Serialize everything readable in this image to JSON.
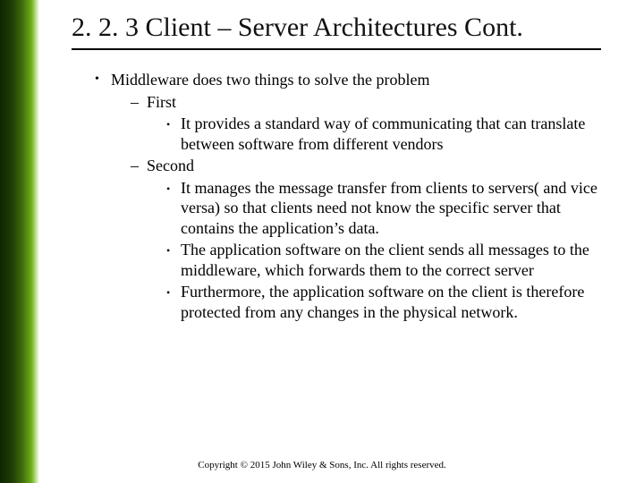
{
  "slide": {
    "title": "2. 2. 3 Client – Server Architectures Cont.",
    "body": {
      "top": "Middleware does two things to solve the problem",
      "first_label": "First",
      "first_items": [
        "It provides a standard way of communicating that can translate between software from different vendors"
      ],
      "second_label": "Second",
      "second_items": [
        "It manages the message transfer from clients to servers( and vice versa) so that clients need not know the specific server that contains the application’s data.",
        "The application software on the client sends all messages to the middleware, which forwards them to the correct server",
        "Furthermore, the application software on the client is therefore protected from any changes in the physical network."
      ]
    },
    "footer": "Copyright © 2015 John Wiley & Sons, Inc. All rights reserved."
  }
}
